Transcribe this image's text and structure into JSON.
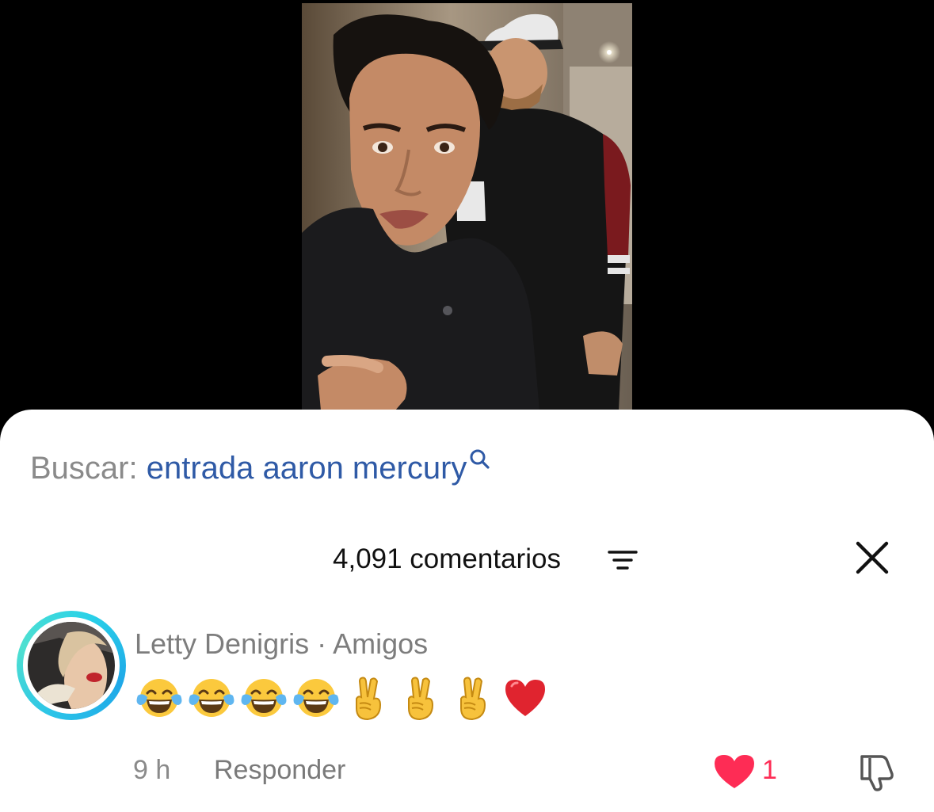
{
  "search": {
    "prefix": "Buscar:",
    "query": "entrada aaron mercury"
  },
  "comments_header": {
    "count_label": "4,091 comentarios"
  },
  "comment": {
    "author": "Letty Denigris · Amigos",
    "emojis": [
      "tears-of-joy-emoji",
      "tears-of-joy-emoji",
      "tears-of-joy-emoji",
      "tears-of-joy-emoji",
      "victory-hand-emoji",
      "victory-hand-emoji",
      "victory-hand-emoji",
      "red-heart-emoji"
    ],
    "time": "9 h",
    "reply_label": "Responder",
    "like_count": "1"
  },
  "colors": {
    "query_link": "#2f5aa6",
    "like_red": "#fe2c55",
    "avatar_ring": "#2ac3e8"
  }
}
